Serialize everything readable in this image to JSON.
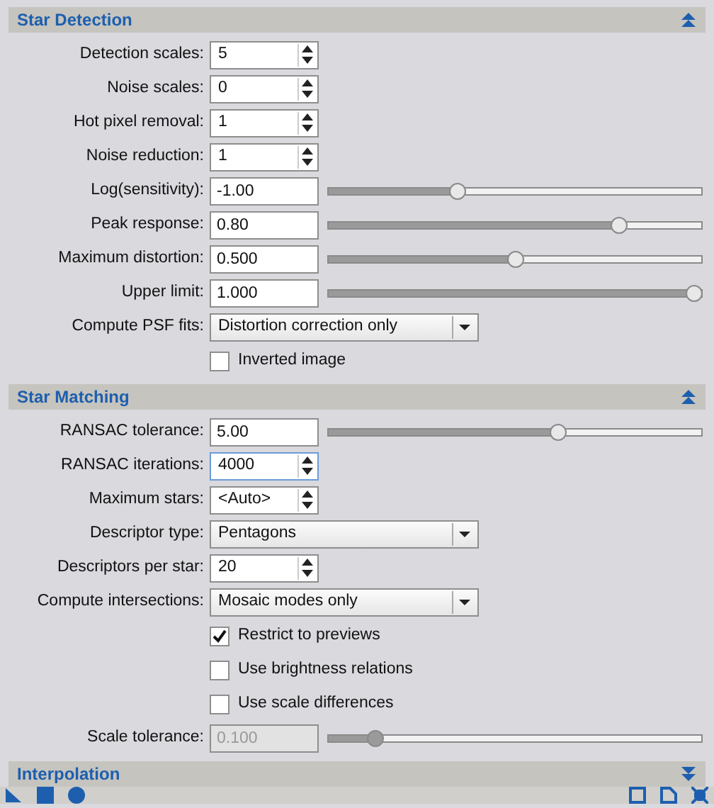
{
  "sections": [
    {
      "title": "Star Detection",
      "expanded": true,
      "rows": [
        {
          "kind": "spin",
          "label": "Detection scales:",
          "value": "5",
          "focused": false
        },
        {
          "kind": "spin",
          "label": "Noise scales:",
          "value": "0",
          "focused": false
        },
        {
          "kind": "spin",
          "label": "Hot pixel removal:",
          "value": "1",
          "focused": false
        },
        {
          "kind": "spin",
          "label": "Noise reduction:",
          "value": "1",
          "focused": false
        },
        {
          "kind": "slider",
          "label": "Log(sensitivity):",
          "value": "-1.00",
          "level": 0.34,
          "disabled": false
        },
        {
          "kind": "slider",
          "label": "Peak response:",
          "value": "0.80",
          "level": 0.79,
          "disabled": false
        },
        {
          "kind": "slider",
          "label": "Maximum distortion:",
          "value": "0.500",
          "level": 0.5,
          "disabled": false
        },
        {
          "kind": "slider",
          "label": "Upper limit:",
          "value": "1.000",
          "level": 1.0,
          "disabled": false
        },
        {
          "kind": "combo",
          "label": "Compute PSF fits:",
          "value": "Distortion correction only"
        },
        {
          "kind": "checkbox",
          "label": "Inverted image",
          "checked": false
        }
      ]
    },
    {
      "title": "Star Matching",
      "expanded": true,
      "rows": [
        {
          "kind": "slider",
          "label": "RANSAC tolerance:",
          "value": "5.00",
          "level": 0.62,
          "disabled": false
        },
        {
          "kind": "spin",
          "label": "RANSAC iterations:",
          "value": "4000",
          "focused": true
        },
        {
          "kind": "spin",
          "label": "Maximum stars:",
          "value": "<Auto>",
          "focused": false
        },
        {
          "kind": "combo",
          "label": "Descriptor type:",
          "value": "Pentagons"
        },
        {
          "kind": "spin",
          "label": "Descriptors per star:",
          "value": "20",
          "focused": false
        },
        {
          "kind": "combo",
          "label": "Compute intersections:",
          "value": "Mosaic modes only"
        },
        {
          "kind": "checkbox",
          "label": "Restrict to previews",
          "checked": true
        },
        {
          "kind": "checkbox",
          "label": "Use brightness relations",
          "checked": false
        },
        {
          "kind": "checkbox",
          "label": "Use scale differences",
          "checked": false
        },
        {
          "kind": "slider",
          "label": "Scale tolerance:",
          "value": "0.100",
          "level": 0.11,
          "disabled": true
        }
      ]
    },
    {
      "title": "Interpolation",
      "expanded": false
    }
  ]
}
